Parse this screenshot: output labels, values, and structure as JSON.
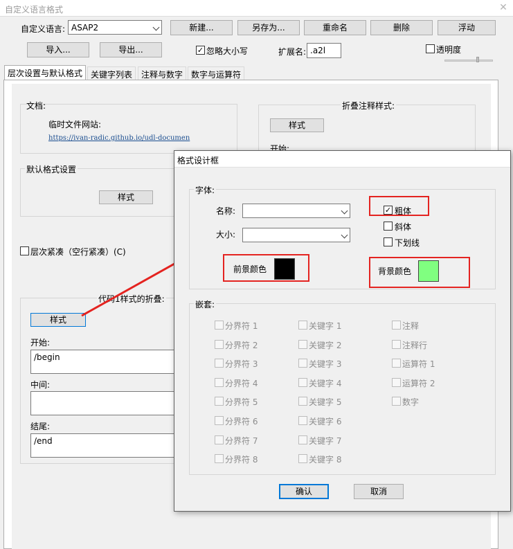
{
  "window": {
    "title": "自定义语言格式"
  },
  "toolbar": {
    "lang_label": "自定义语言:",
    "lang_value": "ASAP2",
    "new_btn": "新建...",
    "saveas_btn": "另存为...",
    "rename_btn": "重命名",
    "delete_btn": "删除",
    "float_btn": "浮动",
    "import_btn": "导入...",
    "export_btn": "导出...",
    "ignorecase_label": "忽略大小写",
    "ext_label": "扩展名:",
    "ext_value": ".a2l",
    "transparency_label": "透明度"
  },
  "tabs": [
    "层次设置与默认格式",
    "关键字列表",
    "注释与数字",
    "数字与运算符"
  ],
  "panel": {
    "doc_group": "文档:",
    "temp_site": "临时文件网站:",
    "url": "https://ivan-radic.github.io/udl-documen",
    "default_style_group": "默认格式设置",
    "style_btn": "样式",
    "fold_comment_group": "折叠注释样式:",
    "fold_style_btn": "样式",
    "fold_start": "开始:",
    "compact_label": "层次紧凑（空行紧凑）(C)",
    "code_fold_group": "代码1样式的折叠:",
    "code_style_btn": "样式",
    "begin_label": "开始:",
    "begin_value": "/begin",
    "middle_label": "中间:",
    "middle_value": "",
    "end_label": "结尾:",
    "end_value": "/end"
  },
  "dialog": {
    "title": "格式设计框",
    "font_group": "字体:",
    "name_label": "名称:",
    "size_label": "大小:",
    "bold_label": "粗体",
    "italic_label": "斜体",
    "underline_label": "下划线",
    "fg_label": "前景颜色",
    "bg_label": "背景颜色",
    "fg_color": "#000000",
    "bg_color": "#80ff80",
    "nesting_group": "嵌套:",
    "nesting": {
      "col1": [
        "分界符 1",
        "分界符 2",
        "分界符 3",
        "分界符 4",
        "分界符 5",
        "分界符 6",
        "分界符 7",
        "分界符 8"
      ],
      "col2": [
        "关键字 1",
        "关键字 2",
        "关键字 3",
        "关键字 4",
        "关键字 5",
        "关键字 6",
        "关键字 7",
        "关键字 8"
      ],
      "col3": [
        "注释",
        "注释行",
        "运算符 1",
        "运算符 2",
        "数字"
      ]
    },
    "ok_btn": "确认",
    "cancel_btn": "取消"
  },
  "colors": {
    "annotation_red": "#e42320",
    "focus_blue": "#0078d7"
  }
}
